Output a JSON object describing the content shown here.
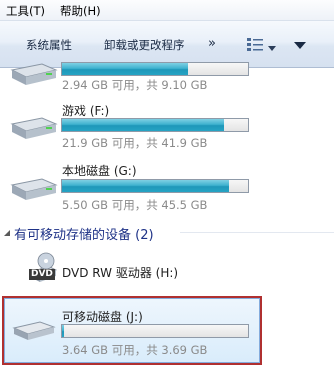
{
  "menubar": {
    "items": [
      "工具(T)",
      "帮助(H)"
    ]
  },
  "toolbar": {
    "system_properties": "系统属性",
    "uninstall": "卸载或更改程序",
    "more": "»"
  },
  "drives": [
    {
      "name": "",
      "space": "2.94 GB 可用，共 9.10 GB",
      "used_fraction": 0.68
    },
    {
      "name": "游戏 (F:)",
      "space": "21.9 GB 可用，共 41.9 GB",
      "used_fraction": 0.48
    },
    {
      "name": "本地磁盘 (G:)",
      "space": "5.50 GB 可用，共 45.5 GB",
      "used_fraction": 0.88
    }
  ],
  "removable_section": {
    "header": "有可移动存储的设备 (2)",
    "dvd": {
      "name": "DVD RW 驱动器 (H:)",
      "badge": "DVD"
    },
    "usb": {
      "name": "可移动磁盘 (J:)",
      "space": "3.64 GB 可用，共 3.69 GB",
      "used_fraction": 0.01
    }
  },
  "colors": {
    "bar_fill": "#26a4c4",
    "selection_border": "#b03030",
    "section_header": "#1e3287"
  }
}
